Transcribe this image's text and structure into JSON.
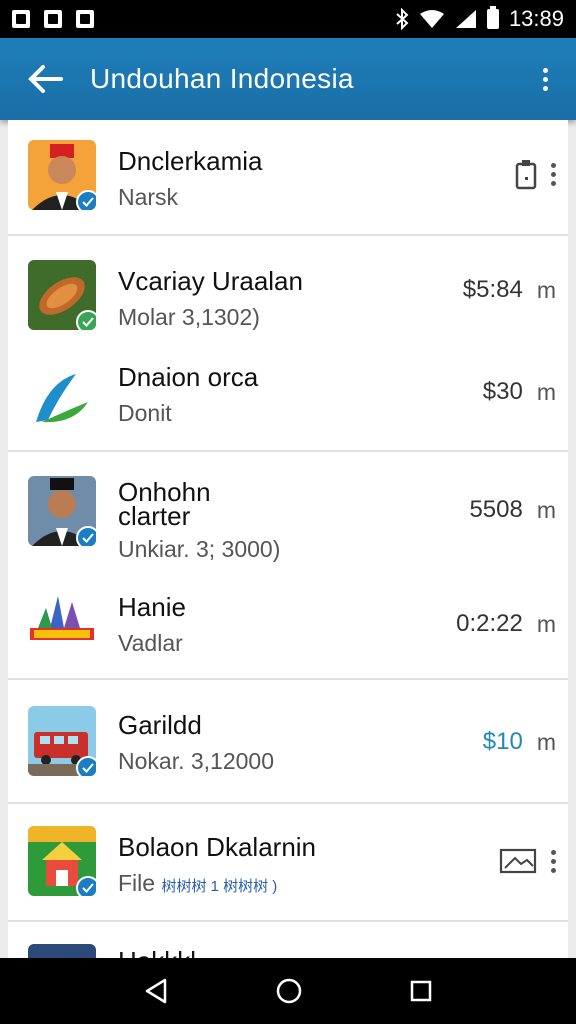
{
  "status": {
    "time": "13:89"
  },
  "app_bar": {
    "title": "Undouhan Indonesia",
    "back_icon": "arrow-left-icon",
    "menu_icon": "more-vert-icon",
    "color": "#1f7fba"
  },
  "items": [
    {
      "title": "Dnclerkamia",
      "subtitle": "Narsk",
      "right_icon": "clipboard-icon",
      "has_menu": true
    },
    {
      "title": "Vcariay Uraalan",
      "subtitle": "Molar 3,1302)",
      "value": "$5:84",
      "unit": "m"
    },
    {
      "title": "Dnaion orca",
      "subtitle": "Donit",
      "value": "$30",
      "unit": "m"
    },
    {
      "title": "Onhohn",
      "title2": "clarter",
      "subtitle": "Unkiar. 3; 3000)",
      "value": "5508",
      "unit": "m"
    },
    {
      "title": "Hanie",
      "subtitle": "Vadlar",
      "value": "0:2:22",
      "unit": "m"
    },
    {
      "title": "Garildd",
      "subtitle": "Nokar. 3,12000",
      "value": "$10",
      "unit": "m",
      "accent": "#1f88b8"
    },
    {
      "title": "Bolaon Dkalarnin",
      "subtitle": "File",
      "subtitle_extra": "树树树 1 树树树 )",
      "right_icon": "image-icon",
      "has_menu": true
    },
    {
      "title": "Hakkkl"
    }
  ],
  "nav": {
    "back": "nav-back-icon",
    "home": "nav-home-icon",
    "recents": "nav-recents-icon"
  }
}
